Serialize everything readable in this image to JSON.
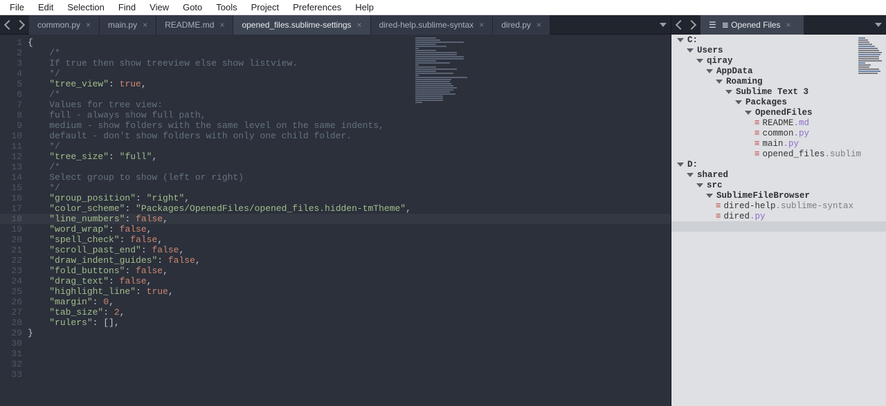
{
  "menu": [
    "File",
    "Edit",
    "Selection",
    "Find",
    "View",
    "Goto",
    "Tools",
    "Project",
    "Preferences",
    "Help"
  ],
  "left": {
    "tabs": [
      {
        "label": "common.py",
        "active": false
      },
      {
        "label": "main.py",
        "active": false
      },
      {
        "label": "README.md",
        "active": false
      },
      {
        "label": "opened_files.sublime-settings",
        "active": true
      },
      {
        "label": "dired-help.sublime-syntax",
        "active": false
      },
      {
        "label": "dired.py",
        "active": false
      }
    ],
    "highlight_line": 18,
    "code": [
      [
        [
          "p",
          "{"
        ]
      ],
      [
        [
          "c",
          "    /*"
        ]
      ],
      [
        [
          "c",
          "    If true then show treeview else show listview."
        ]
      ],
      [
        [
          "c",
          "    */"
        ]
      ],
      [
        [
          "p",
          "    "
        ],
        [
          "s",
          "\"tree_view\""
        ],
        [
          "p",
          ": "
        ],
        [
          "k",
          "true"
        ],
        [
          "p",
          ","
        ]
      ],
      [
        [
          "p",
          ""
        ]
      ],
      [
        [
          "c",
          "    /*"
        ]
      ],
      [
        [
          "c",
          "    Values for tree view:"
        ]
      ],
      [
        [
          "c",
          "    full - always show full path,"
        ]
      ],
      [
        [
          "c",
          "    medium - show folders with the same level on the same indents,"
        ]
      ],
      [
        [
          "c",
          "    default - don't show folders with only one child folder."
        ]
      ],
      [
        [
          "c",
          "    */"
        ]
      ],
      [
        [
          "p",
          "    "
        ],
        [
          "s",
          "\"tree_size\""
        ],
        [
          "p",
          ": "
        ],
        [
          "s",
          "\"full\""
        ],
        [
          "p",
          ","
        ]
      ],
      [
        [
          "p",
          ""
        ]
      ],
      [
        [
          "c",
          "    /*"
        ]
      ],
      [
        [
          "c",
          "    Select group to show (left or right)"
        ]
      ],
      [
        [
          "c",
          "    */"
        ]
      ],
      [
        [
          "p",
          "    "
        ],
        [
          "s",
          "\"group_position\""
        ],
        [
          "p",
          ": "
        ],
        [
          "s",
          "\"right\""
        ],
        [
          "p",
          ","
        ]
      ],
      [
        [
          "p",
          ""
        ]
      ],
      [
        [
          "p",
          "    "
        ],
        [
          "s",
          "\"color_scheme\""
        ],
        [
          "p",
          ": "
        ],
        [
          "s",
          "\"Packages/OpenedFiles/opened_files.hidden-tmTheme\""
        ],
        [
          "p",
          ","
        ]
      ],
      [
        [
          "p",
          "    "
        ],
        [
          "s",
          "\"line_numbers\""
        ],
        [
          "p",
          ": "
        ],
        [
          "k",
          "false"
        ],
        [
          "p",
          ","
        ]
      ],
      [
        [
          "p",
          "    "
        ],
        [
          "s",
          "\"word_wrap\""
        ],
        [
          "p",
          ": "
        ],
        [
          "k",
          "false"
        ],
        [
          "p",
          ","
        ]
      ],
      [
        [
          "p",
          "    "
        ],
        [
          "s",
          "\"spell_check\""
        ],
        [
          "p",
          ": "
        ],
        [
          "k",
          "false"
        ],
        [
          "p",
          ","
        ]
      ],
      [
        [
          "p",
          "    "
        ],
        [
          "s",
          "\"scroll_past_end\""
        ],
        [
          "p",
          ": "
        ],
        [
          "k",
          "false"
        ],
        [
          "p",
          ","
        ]
      ],
      [
        [
          "p",
          "    "
        ],
        [
          "s",
          "\"draw_indent_guides\""
        ],
        [
          "p",
          ": "
        ],
        [
          "k",
          "false"
        ],
        [
          "p",
          ","
        ]
      ],
      [
        [
          "p",
          "    "
        ],
        [
          "s",
          "\"fold_buttons\""
        ],
        [
          "p",
          ": "
        ],
        [
          "k",
          "false"
        ],
        [
          "p",
          ","
        ]
      ],
      [
        [
          "p",
          "    "
        ],
        [
          "s",
          "\"drag_text\""
        ],
        [
          "p",
          ": "
        ],
        [
          "k",
          "false"
        ],
        [
          "p",
          ","
        ]
      ],
      [
        [
          "p",
          "    "
        ],
        [
          "s",
          "\"highlight_line\""
        ],
        [
          "p",
          ": "
        ],
        [
          "k",
          "true"
        ],
        [
          "p",
          ","
        ]
      ],
      [
        [
          "p",
          "    "
        ],
        [
          "s",
          "\"margin\""
        ],
        [
          "p",
          ": "
        ],
        [
          "k",
          "0"
        ],
        [
          "p",
          ","
        ]
      ],
      [
        [
          "p",
          "    "
        ],
        [
          "s",
          "\"tab_size\""
        ],
        [
          "p",
          ": "
        ],
        [
          "k",
          "2"
        ],
        [
          "p",
          ","
        ]
      ],
      [
        [
          "p",
          "    "
        ],
        [
          "s",
          "\"rulers\""
        ],
        [
          "p",
          ": [],"
        ]
      ],
      [
        [
          "p",
          "}"
        ]
      ],
      [
        [
          "p",
          ""
        ]
      ]
    ],
    "minimap_widths": [
      30,
      36,
      70,
      30,
      45,
      5,
      30,
      60,
      60,
      70,
      70,
      30,
      50,
      5,
      30,
      60,
      30,
      55,
      5,
      75,
      52,
      50,
      52,
      55,
      60,
      55,
      50,
      58,
      40,
      40,
      40,
      10
    ]
  },
  "right": {
    "tab": {
      "label": "≣ Opened Files",
      "icon": "☰"
    },
    "tree": [
      {
        "depth": 0,
        "type": "dir",
        "label": "C:"
      },
      {
        "depth": 1,
        "type": "dir",
        "label": "Users"
      },
      {
        "depth": 2,
        "type": "dir",
        "label": "qiray"
      },
      {
        "depth": 3,
        "type": "dir",
        "label": "AppData"
      },
      {
        "depth": 4,
        "type": "dir",
        "label": "Roaming"
      },
      {
        "depth": 5,
        "type": "dir",
        "label": "Sublime Text 3"
      },
      {
        "depth": 6,
        "type": "dir",
        "label": "Packages"
      },
      {
        "depth": 7,
        "type": "dir",
        "label": "OpenedFiles"
      },
      {
        "depth": 8,
        "type": "file",
        "base": "README",
        "ext": ".md",
        "extcls": "c"
      },
      {
        "depth": 8,
        "type": "file",
        "base": "common",
        "ext": ".py",
        "extcls": "c"
      },
      {
        "depth": 8,
        "type": "file",
        "base": "main",
        "ext": ".py",
        "extcls": "c"
      },
      {
        "depth": 8,
        "type": "file",
        "base": "opened_files",
        "ext": ".sublim",
        "extcls": "g",
        "truncated": true
      },
      {
        "depth": 0,
        "type": "dir",
        "label": "D:"
      },
      {
        "depth": 1,
        "type": "dir",
        "label": "shared"
      },
      {
        "depth": 2,
        "type": "dir",
        "label": "src"
      },
      {
        "depth": 3,
        "type": "dir",
        "label": "SublimeFileBrowser"
      },
      {
        "depth": 4,
        "type": "file",
        "base": "dired-help",
        "ext": ".sublime-syntax",
        "extcls": "g"
      },
      {
        "depth": 4,
        "type": "file",
        "base": "dired",
        "ext": ".py",
        "extcls": "c"
      },
      {
        "depth": -1,
        "type": "sel-empty"
      }
    ],
    "minimap_widths": [
      10,
      14,
      16,
      20,
      24,
      28,
      30,
      34,
      32,
      30,
      30,
      34,
      10,
      18,
      16,
      30,
      32,
      28
    ]
  }
}
